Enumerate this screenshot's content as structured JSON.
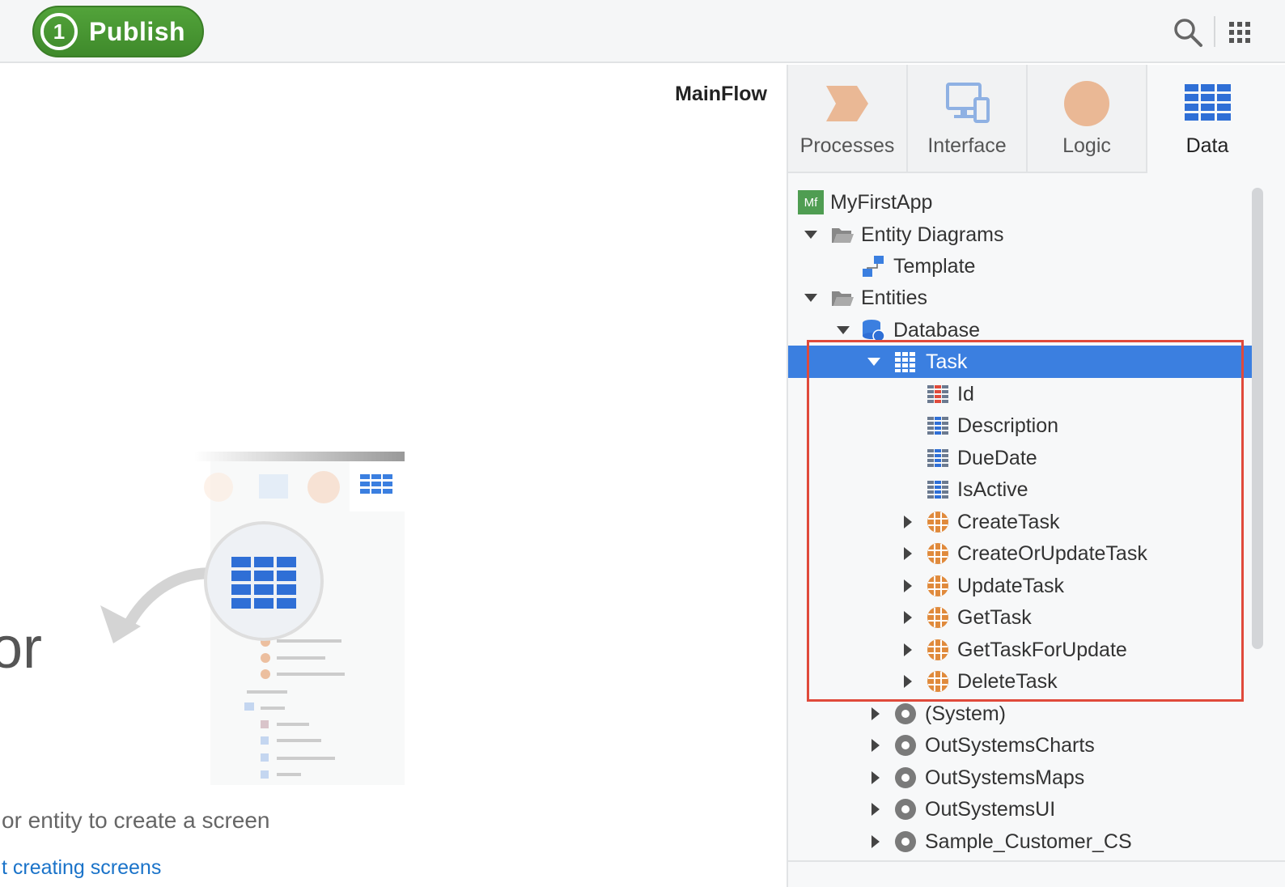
{
  "toolbar": {
    "publish_number": "1",
    "publish_label": "Publish"
  },
  "canvas": {
    "flow_title": "MainFlow",
    "big_text": "or",
    "hint_text": "or entity to create a screen",
    "hint_link": "t creating screens"
  },
  "tabs": [
    {
      "label": "Processes",
      "icon": "processes-icon"
    },
    {
      "label": "Interface",
      "icon": "interface-icon"
    },
    {
      "label": "Logic",
      "icon": "logic-icon"
    },
    {
      "label": "Data",
      "icon": "data-icon",
      "active": true
    }
  ],
  "tree": {
    "root": "MyFirstApp",
    "root_badge": "Mf",
    "entity_diagrams": "Entity Diagrams",
    "template": "Template",
    "entities": "Entities",
    "database": "Database",
    "task": "Task",
    "attributes": [
      "Id",
      "Description",
      "DueDate",
      "IsActive"
    ],
    "actions": [
      "CreateTask",
      "CreateOrUpdateTask",
      "UpdateTask",
      "GetTask",
      "GetTaskForUpdate",
      "DeleteTask"
    ],
    "modules": [
      "(System)",
      "OutSystemsCharts",
      "OutSystemsMaps",
      "OutSystemsUI",
      "Sample_Customer_CS"
    ]
  },
  "colors": {
    "publish_green": "#4a9a34",
    "selection_blue": "#3b7fe0",
    "highlight_red": "#e04a3b",
    "entity_blue": "#2f6fd6",
    "action_orange": "#e08a3c"
  }
}
